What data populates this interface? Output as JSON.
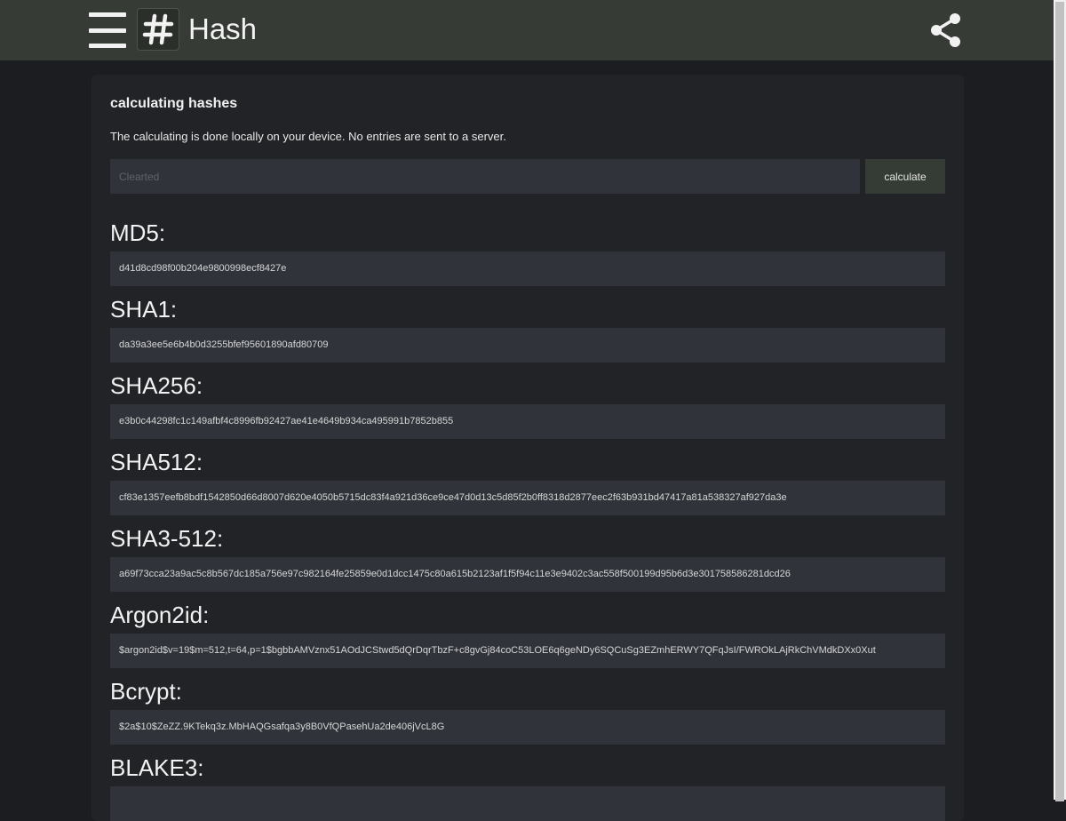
{
  "header": {
    "title": "Hash",
    "menu_icon": "hamburger-menu-icon",
    "logo_icon": "hash-symbol-icon",
    "share_icon": "share-icon",
    "bar_color": "#363c35"
  },
  "card": {
    "title": "calculating hashes",
    "description": "The calculating is done locally on your device. No entries are sent to a server.",
    "input_placeholder": "Clearted",
    "calculate_label": "calculate"
  },
  "hashes": [
    {
      "label": "MD5:",
      "value": "d41d8cd98f00b204e9800998ecf8427e"
    },
    {
      "label": "SHA1:",
      "value": "da39a3ee5e6b4b0d3255bfef95601890afd80709"
    },
    {
      "label": "SHA256:",
      "value": "e3b0c44298fc1c149afbf4c8996fb92427ae41e4649b934ca495991b7852b855"
    },
    {
      "label": "SHA512:",
      "value": "cf83e1357eefb8bdf1542850d66d8007d620e4050b5715dc83f4a921d36ce9ce47d0d13c5d85f2b0ff8318d2877eec2f63b931bd47417a81a538327af927da3e"
    },
    {
      "label": "SHA3-512:",
      "value": "a69f73cca23a9ac5c8b567dc185a756e97c982164fe25859e0d1dcc1475c80a615b2123af1f5f94c11e3e9402c3ac558f500199d95b6d3e301758586281dcd26"
    },
    {
      "label": "Argon2id:",
      "value": "$argon2id$v=19$m=512,t=64,p=1$bgbbAMVznx51AOdJCStwd5dQrDqrTbzF+c8gvGj84coC53LOE6q6geNDy6SQCuSg3EZmhERWY7QFqJsI/FWROkLAjRkChVMdkDXx0Xut"
    },
    {
      "label": "Bcrypt:",
      "value": "$2a$10$ZeZZ.9KTekq3z.MbHAQGsafqa3y8B0VfQPasehUa2de406jVcL8G"
    },
    {
      "label": "BLAKE3:",
      "value": ""
    }
  ]
}
